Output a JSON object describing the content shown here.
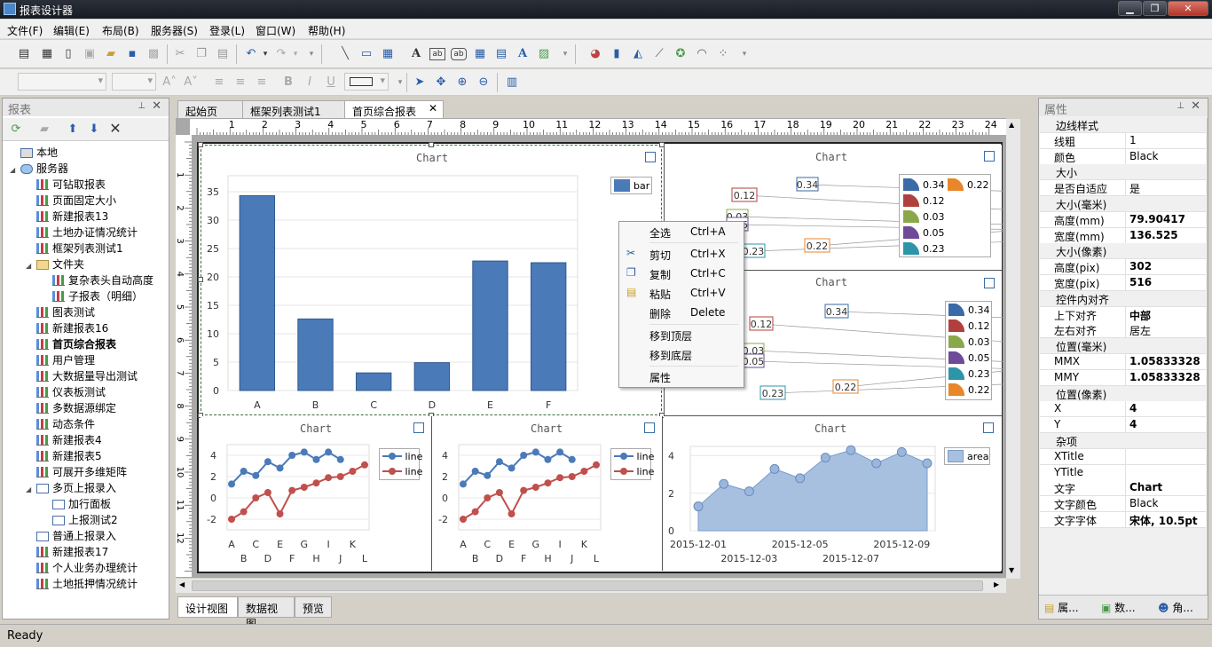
{
  "window": {
    "title": "报表设计器"
  },
  "menu": [
    "文件(F)",
    "编辑(E)",
    "布局(B)",
    "服务器(S)",
    "登录(L)",
    "窗口(W)",
    "帮助(H)"
  ],
  "left_panel": {
    "title": "报表",
    "tree": [
      {
        "label": "本地",
        "level": 0,
        "icon": "computer",
        "expander": ""
      },
      {
        "label": "服务器",
        "level": 0,
        "icon": "cloud",
        "expander": "◢"
      },
      {
        "label": "可钻取报表",
        "level": 1,
        "icon": "chart"
      },
      {
        "label": "页面固定大小",
        "level": 1,
        "icon": "chart"
      },
      {
        "label": "新建报表13",
        "level": 1,
        "icon": "chart"
      },
      {
        "label": "土地办证情况统计",
        "level": 1,
        "icon": "chart"
      },
      {
        "label": "框架列表测试1",
        "level": 1,
        "icon": "chart"
      },
      {
        "label": "文件夹",
        "level": 1,
        "icon": "folder",
        "expander": "◢"
      },
      {
        "label": "复杂表头自动高度",
        "level": 2,
        "icon": "chart"
      },
      {
        "label": "子报表（明细）",
        "level": 2,
        "icon": "chart"
      },
      {
        "label": "图表测试",
        "level": 1,
        "icon": "chart"
      },
      {
        "label": "新建报表16",
        "level": 1,
        "icon": "chart"
      },
      {
        "label": "首页综合报表",
        "level": 1,
        "icon": "chart",
        "selected": true
      },
      {
        "label": "用户管理",
        "level": 1,
        "icon": "chart"
      },
      {
        "label": "大数据量导出测试",
        "level": 1,
        "icon": "chart"
      },
      {
        "label": "仪表板测试",
        "level": 1,
        "icon": "chart"
      },
      {
        "label": "多数据源绑定",
        "level": 1,
        "icon": "chart"
      },
      {
        "label": "动态条件",
        "level": 1,
        "icon": "chart"
      },
      {
        "label": "新建报表4",
        "level": 1,
        "icon": "chart"
      },
      {
        "label": "新建报表5",
        "level": 1,
        "icon": "chart"
      },
      {
        "label": "可展开多维矩阵",
        "level": 1,
        "icon": "chart"
      },
      {
        "label": "多页上报录入",
        "level": 1,
        "icon": "form",
        "expander": "◢"
      },
      {
        "label": "加行面板",
        "level": 2,
        "icon": "form"
      },
      {
        "label": "上报测试2",
        "level": 2,
        "icon": "form"
      },
      {
        "label": "普通上报录入",
        "level": 1,
        "icon": "form"
      },
      {
        "label": "新建报表17",
        "level": 1,
        "icon": "chart"
      },
      {
        "label": "个人业务办理统计",
        "level": 1,
        "icon": "chart"
      },
      {
        "label": "土地抵押情况统计",
        "level": 1,
        "icon": "chart"
      }
    ]
  },
  "doc_tabs": [
    {
      "label": "起始页"
    },
    {
      "label": "框架列表测试1"
    },
    {
      "label": "首页综合报表",
      "active": true
    }
  ],
  "ruler": {
    "labels": [
      "1",
      "2",
      "3",
      "4",
      "5",
      "6",
      "7",
      "8",
      "9",
      "10",
      "11",
      "12",
      "13",
      "14",
      "15",
      "16",
      "17",
      "18",
      "19",
      "20",
      "21",
      "22",
      "23",
      "24"
    ],
    "vlabels": [
      "1",
      "2",
      "3",
      "4",
      "5",
      "6",
      "7",
      "8",
      "9",
      "10",
      "11",
      "12"
    ]
  },
  "context_menu": [
    {
      "label": "全选",
      "shortcut": "Ctrl+A",
      "icon": ""
    },
    {
      "label": "剪切",
      "shortcut": "Ctrl+X",
      "icon": "scissors-icon"
    },
    {
      "label": "复制",
      "shortcut": "Ctrl+C",
      "icon": "copy-icon"
    },
    {
      "label": "粘贴",
      "shortcut": "Ctrl+V",
      "icon": "paste-icon"
    },
    {
      "label": "删除",
      "shortcut": "Delete",
      "icon": ""
    },
    {
      "label": "移到顶层",
      "shortcut": "",
      "icon": ""
    },
    {
      "label": "移到底层",
      "shortcut": "",
      "icon": ""
    },
    {
      "label": "属性",
      "shortcut": "",
      "icon": ""
    }
  ],
  "bottom_tabs": [
    "设计视图",
    "数据视图",
    "预览"
  ],
  "status": "Ready",
  "props_panel": {
    "title": "属性",
    "rows": [
      {
        "cat": true,
        "name": "边线样式"
      },
      {
        "name": "线粗",
        "value": "1"
      },
      {
        "name": "颜色",
        "value": "Black"
      },
      {
        "cat": true,
        "name": "大小"
      },
      {
        "name": "是否自适应",
        "value": "是"
      },
      {
        "cat": true,
        "name": "大小(毫米)"
      },
      {
        "name": "高度(mm)",
        "value": "79.90417",
        "bold": true
      },
      {
        "name": "宽度(mm)",
        "value": "136.525",
        "bold": true
      },
      {
        "cat": true,
        "name": "大小(像素)"
      },
      {
        "name": "高度(pix)",
        "value": "302",
        "bold": true
      },
      {
        "name": "宽度(pix)",
        "value": "516",
        "bold": true
      },
      {
        "cat": true,
        "name": "控件内对齐"
      },
      {
        "name": "上下对齐",
        "value": "中部",
        "bold": true
      },
      {
        "name": "左右对齐",
        "value": "居左"
      },
      {
        "cat": true,
        "name": "位置(毫米)"
      },
      {
        "name": "MMX",
        "value": "1.05833328",
        "bold": true
      },
      {
        "name": "MMY",
        "value": "1.05833328",
        "bold": true
      },
      {
        "cat": true,
        "name": "位置(像素)"
      },
      {
        "name": "X",
        "value": "4",
        "bold": true
      },
      {
        "name": "Y",
        "value": "4",
        "bold": true
      },
      {
        "cat": true,
        "name": "杂项"
      },
      {
        "name": "XTitle",
        "value": ""
      },
      {
        "name": "YTitle",
        "value": ""
      },
      {
        "name": "文字",
        "value": "Chart",
        "bold": true
      },
      {
        "name": "文字颜色",
        "value": "Black"
      },
      {
        "name": "文字字体",
        "value": "宋体, 10.5pt",
        "bold": true
      }
    ],
    "tabs": [
      "属...",
      "数...",
      "角..."
    ]
  },
  "chart_data": [
    {
      "type": "bar",
      "title": "Chart",
      "categories": [
        "A",
        "B",
        "C",
        "D",
        "E",
        "F"
      ],
      "series": [
        {
          "name": "bar",
          "values": [
            34.3,
            12.6,
            3.1,
            4.9,
            22.8,
            22.5
          ]
        }
      ],
      "ylim": [
        0,
        35
      ],
      "yticks": [
        0,
        5,
        10,
        15,
        20,
        25,
        30,
        35
      ]
    },
    {
      "type": "pie",
      "title": "Chart",
      "values": [
        0.34,
        0.12,
        0.03,
        0.05,
        0.23,
        0.22
      ],
      "labels": [
        "0.34",
        "0.12",
        "0.03",
        "0.05",
        "0.23",
        "0.22"
      ],
      "colors": [
        "#3a6aa8",
        "#b0403e",
        "#8aa84a",
        "#6e4a98",
        "#2e94a8",
        "#e8862a"
      ]
    },
    {
      "type": "pie",
      "title": "Chart",
      "values": [
        0.34,
        0.12,
        0.03,
        0.05,
        0.23,
        0.22
      ],
      "labels": [
        "0.34",
        "0.12",
        "0.03",
        "0.05",
        "0.23",
        "0.22"
      ],
      "colors": [
        "#3a6aa8",
        "#b0403e",
        "#8aa84a",
        "#6e4a98",
        "#2e94a8",
        "#e8862a"
      ]
    },
    {
      "type": "line",
      "title": "Chart",
      "categories": [
        "A",
        "B",
        "C",
        "D",
        "E",
        "F",
        "G",
        "H",
        "I",
        "J",
        "K",
        "L"
      ],
      "ylim": [
        -3,
        5
      ],
      "yticks": [
        -2,
        0,
        2,
        4
      ],
      "series": [
        {
          "name": "line",
          "values": [
            1.3,
            2.5,
            2.1,
            3.4,
            2.8,
            4.0,
            4.3,
            3.6,
            4.3,
            3.6
          ]
        },
        {
          "name": "line",
          "values": [
            -2.0,
            -1.3,
            0.0,
            0.5,
            -1.5,
            0.7,
            1.0,
            1.4,
            1.9,
            2.0,
            2.5,
            3.1
          ]
        }
      ]
    },
    {
      "type": "line",
      "title": "Chart",
      "categories": [
        "A",
        "B",
        "C",
        "D",
        "E",
        "F",
        "G",
        "H",
        "I",
        "J",
        "K",
        "L"
      ],
      "ylim": [
        -3,
        5
      ],
      "yticks": [
        -2,
        0,
        2,
        4
      ],
      "series": [
        {
          "name": "line",
          "values": [
            1.3,
            2.5,
            2.1,
            3.4,
            2.8,
            4.0,
            4.3,
            3.6,
            4.3,
            3.6
          ]
        },
        {
          "name": "line",
          "values": [
            -2.0,
            -1.3,
            0.0,
            0.5,
            -1.5,
            0.7,
            1.0,
            1.4,
            1.9,
            2.0,
            2.5,
            3.1
          ]
        }
      ]
    },
    {
      "type": "area",
      "title": "Chart",
      "x": [
        "2015-12-01",
        "2015-12-02",
        "2015-12-03",
        "2015-12-04",
        "2015-12-05",
        "2015-12-06",
        "2015-12-07",
        "2015-12-08",
        "2015-12-09",
        "2015-12-10"
      ],
      "xticklabels_top": [
        "2015-12-01",
        "2015-12-05",
        "2015-12-09"
      ],
      "xticklabels_bottom": [
        "2015-12-03",
        "2015-12-07"
      ],
      "series": [
        {
          "name": "area",
          "values": [
            1.3,
            2.5,
            2.1,
            3.3,
            2.8,
            3.9,
            4.3,
            3.6,
            4.2,
            3.6
          ]
        }
      ],
      "ylim": [
        0,
        4.5
      ],
      "yticks": [
        0,
        2,
        4
      ]
    }
  ],
  "colors": {
    "bar": "#4a7ab8",
    "line1": "#4a7ab8",
    "line2": "#c0504d",
    "area": "#a8c0e0",
    "area_stroke": "#7a9cc8",
    "selection": "#3a6e3a"
  }
}
